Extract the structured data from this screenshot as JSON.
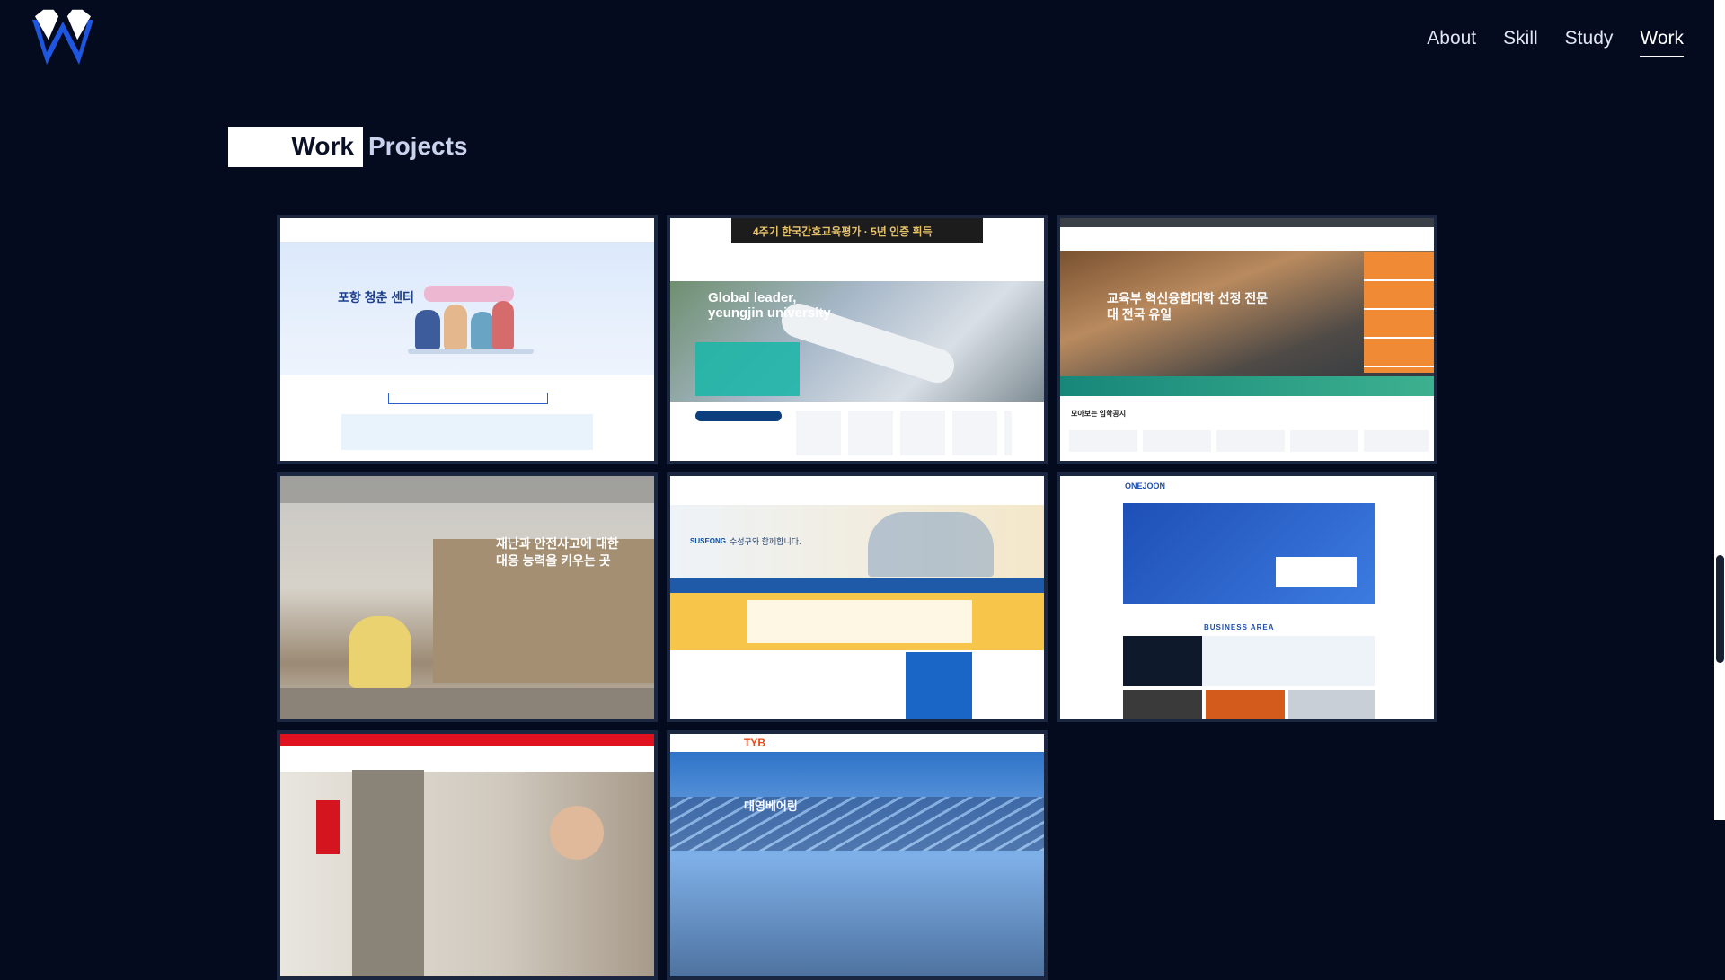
{
  "header": {
    "nav": [
      {
        "label": "About"
      },
      {
        "label": "Skill"
      },
      {
        "label": "Study"
      },
      {
        "label": "Work",
        "active": true
      }
    ]
  },
  "section": {
    "title_highlight": "Work",
    "title_rest": "Projects"
  },
  "projects": [
    {
      "headline": "포항 청춘 센터"
    },
    {
      "banner": "4주기 한국간호교육평가 · 5년 인증 획득",
      "headline": "Global leader, yeungjin university"
    },
    {
      "headline": "교육부 혁신융합대학 선정 전문대 전국 유일",
      "sub": "모아보는 입학공지"
    },
    {
      "headline": "재난과 안전사고에 대한 대응 능력을 키우는 곳"
    },
    {
      "brand": "SUSEONG",
      "headline": "수성구와 함께합니다."
    },
    {
      "brand": "ONEJOON",
      "section": "BUSINESS AREA"
    },
    {
      "headline": ""
    },
    {
      "brand": "TYB",
      "headline": "대영베어링"
    }
  ],
  "colors": {
    "background": "#050b1e",
    "accent": "#ffffff",
    "logo_blue": "#1e56e0"
  }
}
